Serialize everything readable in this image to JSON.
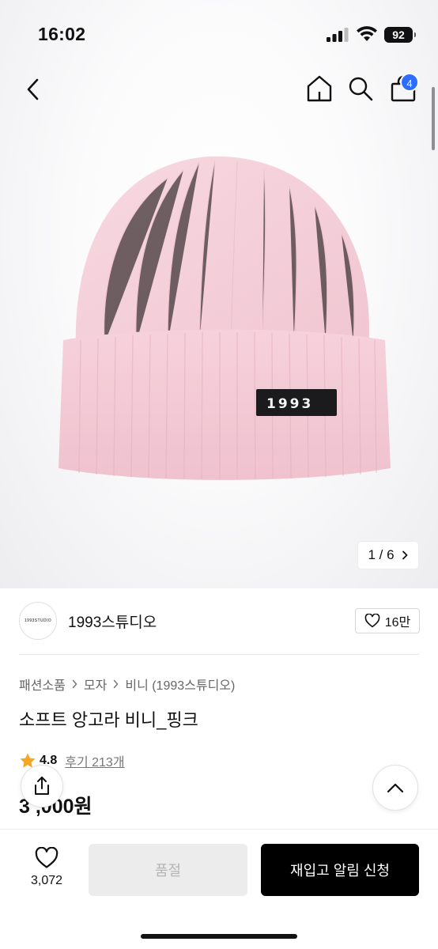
{
  "status_bar": {
    "time": "16:02",
    "battery": "92",
    "icons": [
      "signal-icon",
      "wifi-icon",
      "battery-icon"
    ]
  },
  "nav": {
    "icons": [
      "back-chevron-icon",
      "home-icon",
      "search-icon",
      "shopping-bag-icon"
    ],
    "cart_badge": "4"
  },
  "product_image": {
    "patch_text": "1993",
    "counter": "1 / 6",
    "counter_icon": "chevron-right-icon"
  },
  "brand": {
    "logo_text": "1993STUDIO",
    "name": "1993스튜디오",
    "like_count": "16만",
    "like_icon": "heart-outline-icon"
  },
  "breadcrumb": {
    "items": [
      "패션소품",
      "모자",
      "비니 (1993스튜디오)"
    ],
    "separator_icon": "chevron-right-icon"
  },
  "product": {
    "title": "소프트 앙고라 비니_핑크",
    "rating": "4.8",
    "review_label": "후기 213개",
    "price": "3 ,000원",
    "star_color": "#f5a623"
  },
  "floating": {
    "share_icon": "share-icon",
    "top_icon": "chevron-up-icon"
  },
  "bottom_bar": {
    "wish_count": "3,072",
    "soldout_label": "품절",
    "restock_label": "재입고 알림 신청"
  },
  "colors": {
    "accent": "#2f6dff",
    "primary_button": "#000000",
    "disabled_button": "#ececec",
    "beanie": "#f4cfd9"
  }
}
